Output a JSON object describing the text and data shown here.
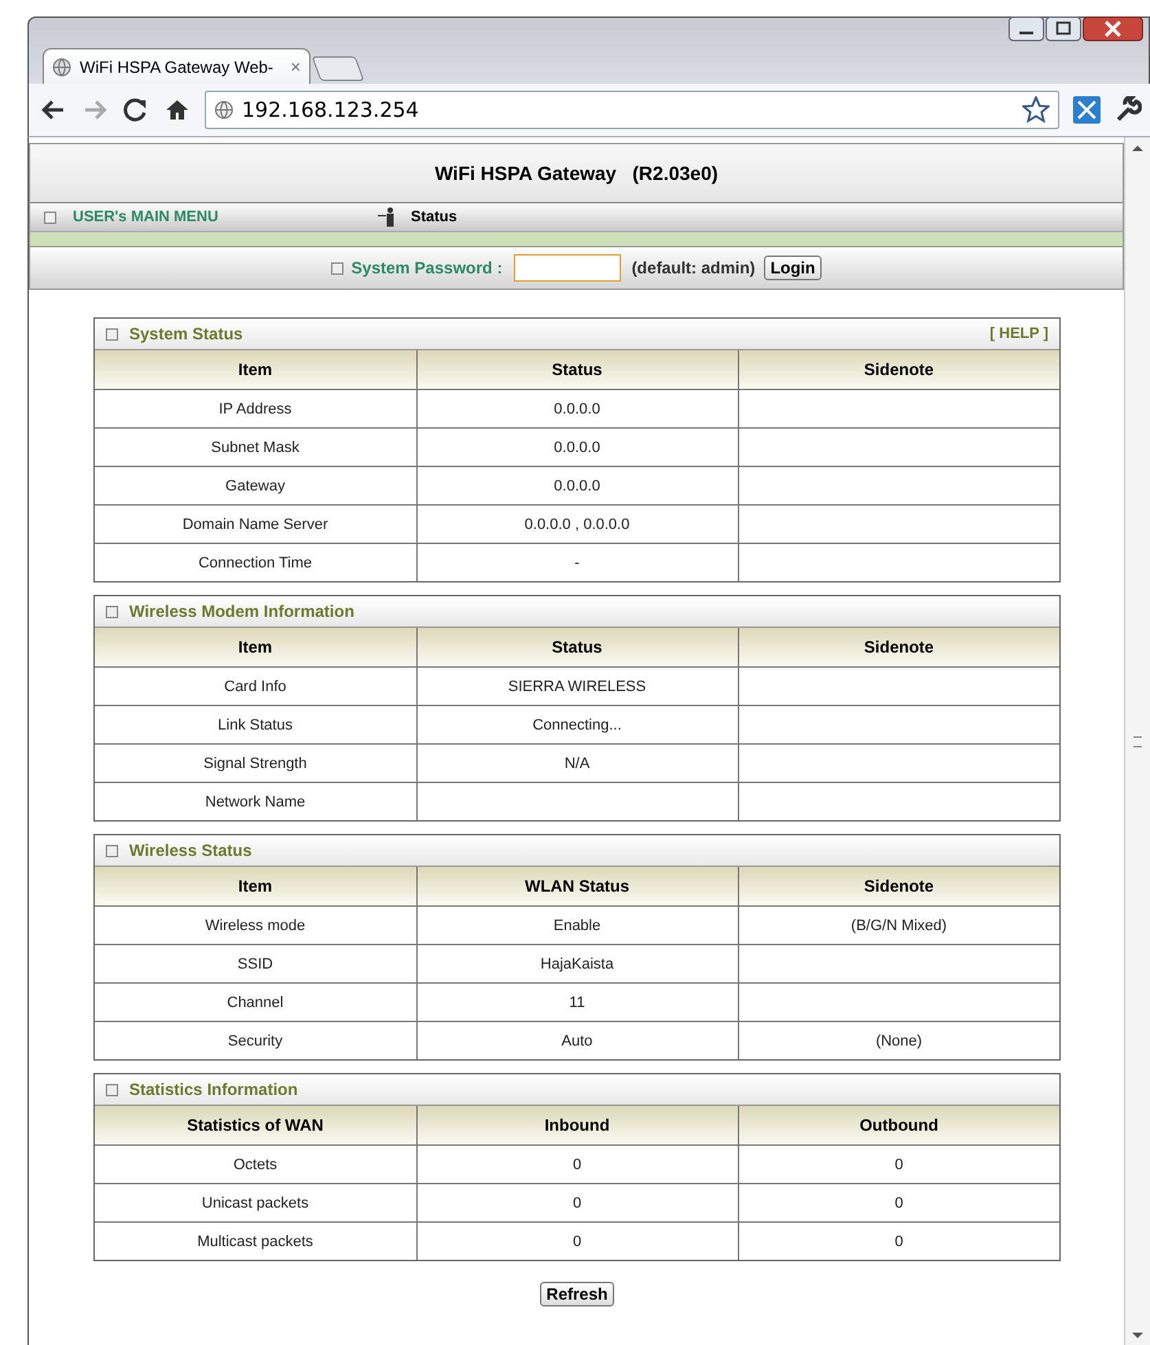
{
  "browser": {
    "tab_title": "WiFi HSPA Gateway Web-",
    "tab_close": "×",
    "address": "192.168.123.254"
  },
  "header": {
    "title": "WiFi HSPA Gateway   (R2.03e0)",
    "menu": "USER's MAIN MENU",
    "breadcrumb": "Status"
  },
  "login": {
    "label": "System Password :",
    "hint": "(default: admin)",
    "button": "Login"
  },
  "sections": [
    {
      "title": "System Status",
      "help": "[ HELP ]",
      "columns": [
        "Item",
        "Status",
        "Sidenote"
      ],
      "rows": [
        [
          "IP Address",
          "0.0.0.0",
          ""
        ],
        [
          "Subnet Mask",
          "0.0.0.0",
          ""
        ],
        [
          "Gateway",
          "0.0.0.0",
          ""
        ],
        [
          "Domain Name Server",
          "0.0.0.0 , 0.0.0.0",
          ""
        ],
        [
          "Connection Time",
          "-",
          ""
        ]
      ]
    },
    {
      "title": "Wireless Modem Information",
      "columns": [
        "Item",
        "Status",
        "Sidenote"
      ],
      "rows": [
        [
          "Card Info",
          "SIERRA WIRELESS",
          ""
        ],
        [
          "Link Status",
          "Connecting...",
          ""
        ],
        [
          "Signal Strength",
          "N/A",
          ""
        ],
        [
          "Network Name",
          "",
          ""
        ]
      ]
    },
    {
      "title": "Wireless Status",
      "columns": [
        "Item",
        "WLAN Status",
        "Sidenote"
      ],
      "rows": [
        [
          "Wireless mode",
          "Enable",
          "(B/G/N Mixed)"
        ],
        [
          "SSID",
          "HajaKaista",
          ""
        ],
        [
          "Channel",
          "11",
          ""
        ],
        [
          "Security",
          "Auto",
          "(None)"
        ]
      ]
    },
    {
      "title": "Statistics Information",
      "columns": [
        "Statistics of WAN",
        "Inbound",
        "Outbound"
      ],
      "rows": [
        [
          "Octets",
          "0",
          "0"
        ],
        [
          "Unicast packets",
          "0",
          "0"
        ],
        [
          "Multicast packets",
          "0",
          "0"
        ]
      ]
    }
  ],
  "refresh_button": "Refresh"
}
